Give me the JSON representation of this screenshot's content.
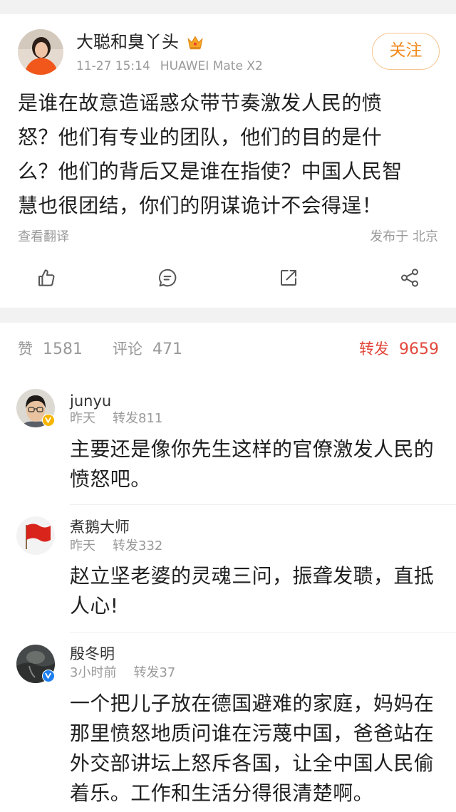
{
  "post": {
    "author_name": "大聪和臭丫头",
    "author_badge_icon": "crown-badge-icon",
    "time": "11-27 15:14",
    "device": "HUAWEI Mate X2",
    "follow_label": "关注",
    "content_lines": [
      "是谁在故意造谣惑众带节奏激发人民的愤",
      "怒？他们有专业的团队，他们的目的是什",
      "么？他们的背后又是谁在指使？中国人民智",
      "慧也很团结，你们的阴谋诡计不会得逞！"
    ],
    "translate_label": "查看翻译",
    "location": "发布于 北京",
    "action_icons": [
      "thumbs-up-icon",
      "comment-icon",
      "repost-icon",
      "share-icon"
    ]
  },
  "tabs": {
    "likes_label": "赞",
    "likes_count": "1581",
    "comments_label": "评论",
    "comments_count": "471",
    "reposts_label": "转发",
    "reposts_count": "9659"
  },
  "reposts": [
    {
      "name": "junyu",
      "time": "昨天",
      "repost": "转发811",
      "badge_icon": "verified-yellow-badge-icon",
      "lines": [
        "主要还是像你先生这样的官僚激发人民的",
        "愤怒吧。"
      ]
    },
    {
      "name": "煮鹅大师",
      "time": "昨天",
      "repost": "转发332",
      "lines": [
        "赵立坚老婆的灵魂三问，振聋发聩，直抵",
        "人心!"
      ]
    },
    {
      "name": "殷冬明",
      "time": "3小时前",
      "repost": "转发37",
      "badge_icon": "verified-blue-badge-icon",
      "lines": [
        "一个把儿子放在德国避难的家庭，妈妈在",
        "那里愤怒地质问谁在污蔑中国，爸爸站在",
        "外交部讲坛上怒斥各国，让全中国人民偷",
        "着乐。工作和生活分得很清楚啊。"
      ]
    }
  ],
  "colors": {
    "accent_red": "#e2473b",
    "follow_orange": "#f28a1e",
    "verified_yellow": "#f7b500",
    "verified_blue": "#1d7ff0",
    "band_gray": "#f2f2f2"
  }
}
